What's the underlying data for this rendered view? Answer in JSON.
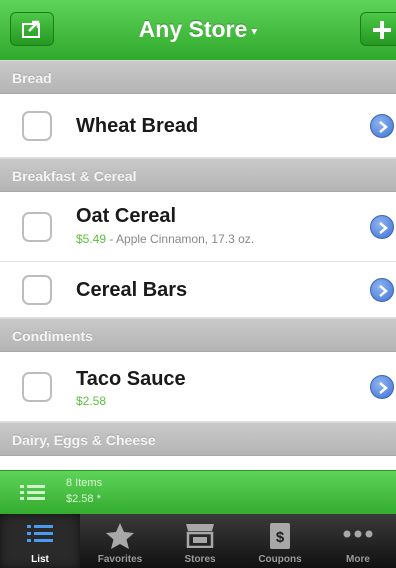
{
  "nav": {
    "title": "Any Store",
    "caret": "▾"
  },
  "sections": {
    "bread": "Bread",
    "breakfast": "Breakfast & Cereal",
    "condiments": "Condiments",
    "dairy": "Dairy, Eggs & Cheese"
  },
  "items": [
    {
      "name": "Wheat Bread"
    },
    {
      "name": "Oat Cereal",
      "price": "$5.49",
      "detail": " - Apple Cinnamon, 17.3 oz."
    },
    {
      "name": "Cereal Bars"
    },
    {
      "name": "Taco Sauce",
      "price": "$2.58"
    }
  ],
  "summary": {
    "count": "8 Items",
    "total": "$2.58 *"
  },
  "tabs": [
    {
      "label": "List",
      "icon": "list-icon",
      "active": true
    },
    {
      "label": "Favorites",
      "icon": "star-icon"
    },
    {
      "label": "Stores",
      "icon": "store-icon"
    },
    {
      "label": "Coupons",
      "icon": "coupon-icon"
    },
    {
      "label": "More",
      "icon": "more-icon"
    }
  ],
  "colors": {
    "accent_green": "#3dbb38",
    "disclosure_blue": "#3f73d4",
    "price_green": "#5cc23c"
  }
}
